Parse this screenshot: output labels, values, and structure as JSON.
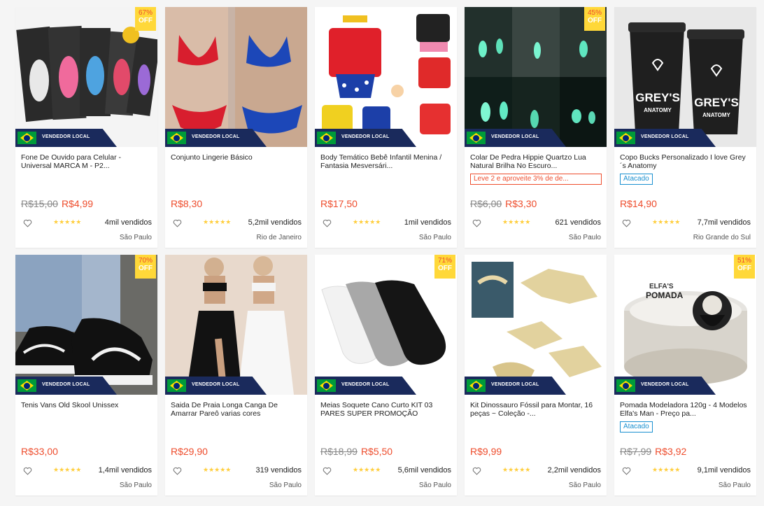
{
  "seller_label": "VENDEDOR LOCAL",
  "off_label": "OFF",
  "colors": {
    "accent": "#ee4d2d",
    "badge": "#ffd839",
    "seller_bg": "#1a2a5c",
    "promo_blue": "#1a90d0"
  },
  "products": [
    {
      "title": "Fone De Ouvido para Celular - Universal MARCA M - P2...",
      "discount": "67%",
      "orig_price": "R$15,00",
      "price": "R$4,99",
      "sold": "4mil vendidos",
      "location": "São Paulo",
      "promo": "",
      "promo_type": "",
      "art": "earphones"
    },
    {
      "title": "Conjunto Lingerie Básico",
      "discount": "",
      "orig_price": "",
      "price": "R$8,30",
      "sold": "5,2mil vendidos",
      "location": "Rio de Janeiro",
      "promo": "",
      "promo_type": "",
      "art": "lingerie"
    },
    {
      "title": "Body Temático Bebê Infantil Menina / Fantasia Mesversári...",
      "discount": "",
      "orig_price": "",
      "price": "R$17,50",
      "sold": "1mil vendidos",
      "location": "São Paulo",
      "promo": "",
      "promo_type": "",
      "art": "bodies"
    },
    {
      "title": "Colar De Pedra Hippie Quartzo Lua Natural Brilha No Escuro...",
      "discount": "45%",
      "orig_price": "R$6,00",
      "price": "R$3,30",
      "sold": "621 vendidos",
      "location": "São Paulo",
      "promo": "Leve 2 e aproveite 3% de de...",
      "promo_type": "red",
      "art": "necklace"
    },
    {
      "title": "Copo Bucks Personalizado I love Grey´s Anatomy",
      "discount": "",
      "orig_price": "",
      "price": "R$14,90",
      "sold": "7,7mil vendidos",
      "location": "Rio Grande do Sul",
      "promo": "Atacado",
      "promo_type": "blue",
      "art": "cups"
    },
    {
      "title": "Tenis Vans Old Skool Unissex",
      "discount": "70%",
      "orig_price": "",
      "price": "R$33,00",
      "sold": "1,4mil vendidos",
      "location": "São Paulo",
      "promo": "",
      "promo_type": "",
      "art": "sneakers"
    },
    {
      "title": "Saida De Praia Longa Canga De Amarrar Pareô varias cores",
      "discount": "",
      "orig_price": "",
      "price": "R$29,90",
      "sold": "319 vendidos",
      "location": "São Paulo",
      "promo": "",
      "promo_type": "",
      "art": "beachwear"
    },
    {
      "title": "Meias Soquete Cano Curto KIT 03 PARES SUPER PROMOÇÃO",
      "discount": "71%",
      "orig_price": "R$18,99",
      "price": "R$5,50",
      "sold": "5,6mil vendidos",
      "location": "São Paulo",
      "promo": "",
      "promo_type": "",
      "art": "socks"
    },
    {
      "title": "Kit Dinossauro Fóssil para Montar, 16 peças ~ Coleção -...",
      "discount": "",
      "orig_price": "",
      "price": "R$9,99",
      "sold": "2,2mil vendidos",
      "location": "São Paulo",
      "promo": "",
      "promo_type": "",
      "art": "dinos"
    },
    {
      "title": "Pomada Modeladora 120g - 4 Modelos Elfa's Man - Preço pa...",
      "discount": "51%",
      "orig_price": "R$7,99",
      "price": "R$3,92",
      "sold": "9,1mil vendidos",
      "location": "São Paulo",
      "promo": "Atacado",
      "promo_type": "blue",
      "art": "pomade"
    }
  ],
  "art_text": {
    "cups_brand": "GREY'S",
    "cups_sub": "ANATOMY",
    "pomade_brand": "ELFA'S",
    "pomade_name": "POMADA"
  }
}
